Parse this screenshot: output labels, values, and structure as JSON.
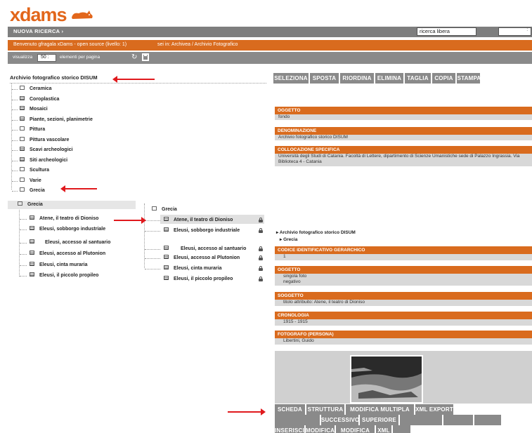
{
  "app": {
    "logo": "xdams"
  },
  "nav": {
    "new_search": "NUOVA RICERCA ›",
    "search_value": "ricerca libera",
    "search_mode": ": "
  },
  "welcome": {
    "text": "Benvenuto gfragala xDams - open source (livello: 1)",
    "path": "sei in: Archivea / Archivio Fotografico"
  },
  "view": {
    "label": "visualizza",
    "page_size": "50 :",
    "suffix": "elementi per pagina"
  },
  "tree": {
    "root": "Archivio fotografico storico DISUM",
    "items": [
      "Ceramica",
      "Coroplastica",
      "Mosaici",
      "Piante, sezioni, planimetrie",
      "Pittura",
      "Pittura vascolare",
      "Scavi archeologici",
      "Siti archeologici",
      "Scultura",
      "Varie",
      "Grecia"
    ],
    "item_types": [
      "folder",
      "doc",
      "doc",
      "doc",
      "folder",
      "folder",
      "doc",
      "doc",
      "folder",
      "folder",
      "folder"
    ]
  },
  "tree2": {
    "root": "Grecia",
    "items": [
      "Atene, il teatro di Dioniso",
      "Eleusi, sobborgo industriale",
      "Eleusi, accesso al santuario",
      "Eleusi, accesso al Plutonion",
      "Eleusi, cinta muraria",
      "Eleusi, il piccolo propileo"
    ]
  },
  "tree3": {
    "root": "Grecia",
    "items": [
      "Atene, il teatro di Dioniso",
      "Eleusi, sobborgo industriale",
      "Eleusi, accesso al santuario",
      "Eleusi, accesso al Plutonion",
      "Eleusi, cinta muraria",
      "Eleusi, il piccolo propileo"
    ]
  },
  "top_toolbar": [
    "SELEZIONA",
    "SPOSTA",
    "RIORDINA",
    "ELIMINA",
    "TAGLIA",
    "COPIA",
    "STAMPA"
  ],
  "fields_top": [
    {
      "label": "OGGETTO",
      "value": "fondo"
    },
    {
      "label": "DENOMINAZIONE",
      "value": "Archivio fotografico storico DISUM"
    },
    {
      "label": "COLLOCAZIONE SPECIFICA",
      "value": "Università degli Studi di Catania. Facoltà di Lettere, dipartimento di Scienze Umanistiche sede di Palazzo Ingrassia. Via Biblioteca 4 - Catania"
    }
  ],
  "breadcrumb": {
    "root": "Archivio fotografico storico DISUM",
    "child": "Grecia"
  },
  "fields_bottom": [
    {
      "label": "CODICE IDENTIFICATIVO GERARCHICO",
      "value": "1"
    },
    {
      "label": "OGGETTO",
      "value": "singola foto",
      "value2": "negativo"
    },
    {
      "label": "SOGGETTO",
      "value": "titolo attribuito: Atene, il teatro di Dioniso"
    },
    {
      "label": "CRONOLOGIA",
      "value": "1915 - 1915"
    },
    {
      "label": "FOTOGRAFO (PERSONA)",
      "value": "Libertini, Guido"
    }
  ],
  "bottom_toolbar_1": [
    "SCHEDA",
    "STRUTTURA",
    "MODIFICA MULTIPLA",
    "XML EXPORT"
  ],
  "bottom_toolbar_2": [
    "SUCCESSIVO",
    "SUPERIORE"
  ],
  "bottom_toolbar_3": [
    "INSERISCI",
    "MODIFICA",
    "MODIFICA XML",
    "XML"
  ],
  "colors": {
    "accent": "#d96b1e",
    "toolbar": "#8a8a8a",
    "arrow": "#e0191d"
  }
}
